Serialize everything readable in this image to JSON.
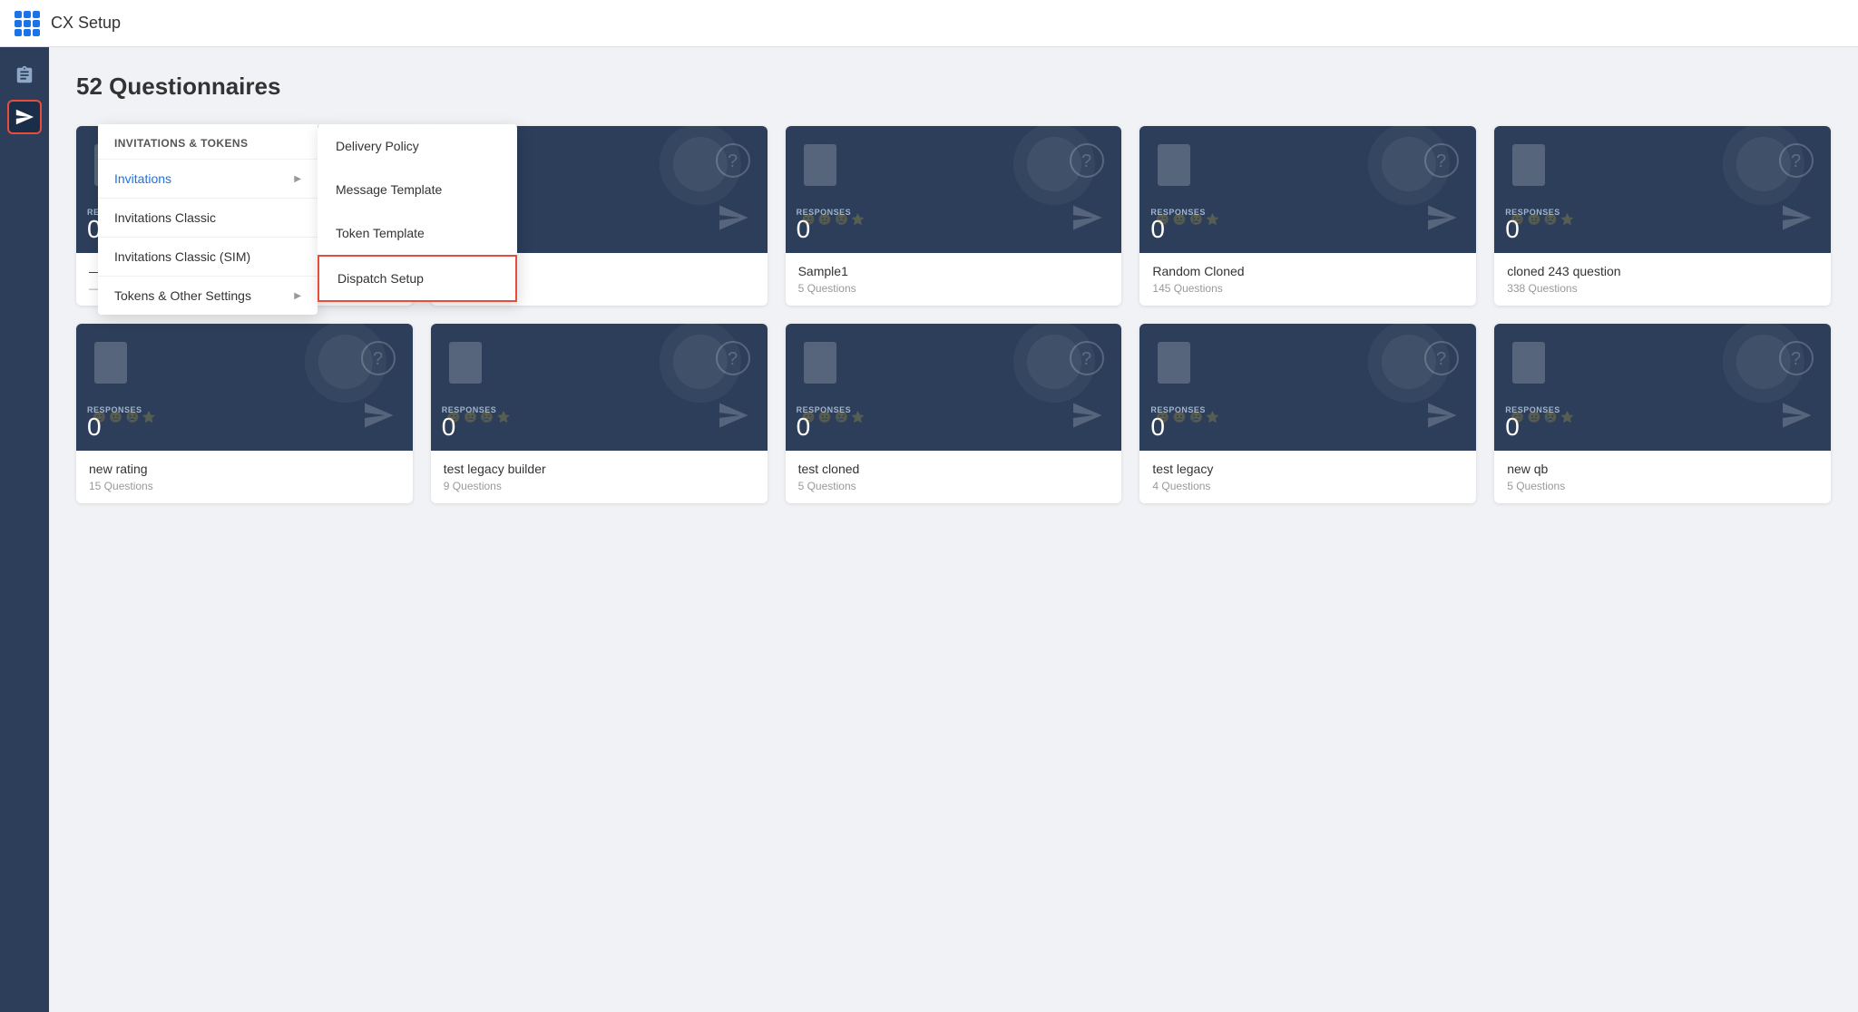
{
  "app": {
    "title": "CX Setup"
  },
  "header": {
    "questionnaire_count": "52",
    "questionnaire_label": "Questionnaires"
  },
  "sidebar": {
    "icons": [
      {
        "name": "clipboard-icon",
        "symbol": "📋",
        "active": false
      },
      {
        "name": "invitations-icon",
        "symbol": "↗",
        "active": true
      }
    ]
  },
  "left_panel": {
    "header": "Invitations & Tokens",
    "items": [
      {
        "label": "Invitations",
        "active": true,
        "has_submenu": true
      },
      {
        "label": "Invitations Classic",
        "active": false,
        "has_submenu": false
      },
      {
        "label": "Invitations Classic (SIM)",
        "active": false,
        "has_submenu": false
      },
      {
        "label": "Tokens & Other Settings",
        "active": false,
        "has_submenu": true
      }
    ]
  },
  "right_submenu": {
    "items": [
      {
        "label": "Delivery Policy",
        "highlighted": false
      },
      {
        "label": "Message Template",
        "highlighted": false
      },
      {
        "label": "Token Template",
        "highlighted": false
      },
      {
        "label": "Dispatch Setup",
        "highlighted": true
      }
    ]
  },
  "cards_row1": [
    {
      "responses": "RESPONSES",
      "count": "0",
      "name": "Sample1",
      "questions": "5 Questions"
    },
    {
      "responses": "RESPONSES",
      "count": "0",
      "name": "Random Cloned",
      "questions": "145 Questions"
    },
    {
      "responses": "RESPONSES",
      "count": "0",
      "name": "cloned 243 question",
      "questions": "338 Questions"
    }
  ],
  "cards_row2": [
    {
      "responses": "RESPONSES",
      "count": "0",
      "name": "new rating",
      "questions": "15 Questions"
    },
    {
      "responses": "RESPONSES",
      "count": "0",
      "name": "test legacy builder",
      "questions": "9 Questions"
    },
    {
      "responses": "RESPONSES",
      "count": "0",
      "name": "test cloned",
      "questions": "5 Questions"
    },
    {
      "responses": "RESPONSES",
      "count": "0",
      "name": "test legacy",
      "questions": "4 Questions"
    },
    {
      "responses": "RESPONSES",
      "count": "0",
      "name": "new qb",
      "questions": "5 Questions"
    }
  ]
}
